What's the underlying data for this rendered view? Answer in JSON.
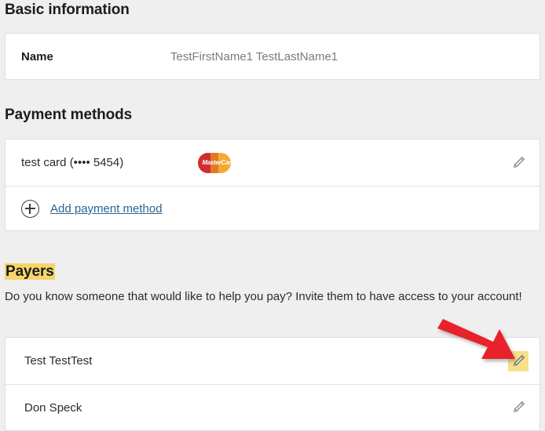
{
  "sections": {
    "basic": {
      "heading": "Basic information",
      "rows": [
        {
          "label": "Name",
          "value": "TestFirstName1 TestLastName1"
        }
      ]
    },
    "payment": {
      "heading": "Payment methods",
      "cards": [
        {
          "name": "test card (•••• 5454)",
          "brand": "MasterCard",
          "brand_colors": {
            "left": "#d32d2f",
            "right": "#f4a933"
          },
          "edit_icon": "pencil-icon"
        }
      ],
      "add_link": {
        "icon": "circle-plus-icon",
        "label": "Add payment method",
        "color": "#2a6496"
      }
    },
    "payers": {
      "heading": "Payers",
      "heading_highlight_color": "#f3d66b",
      "description": "Do you know someone that would like to help you pay? Invite them to have access to your account!",
      "rows": [
        {
          "name": "Test TestTest",
          "edit_icon": "pencil-icon",
          "highlighted": true
        },
        {
          "name": "Don Speck",
          "edit_icon": "pencil-icon",
          "highlighted": false
        }
      ]
    }
  },
  "annotation": {
    "arrow_color": "#e8232a",
    "points_at": "edit-payer-button-test-testtest"
  }
}
